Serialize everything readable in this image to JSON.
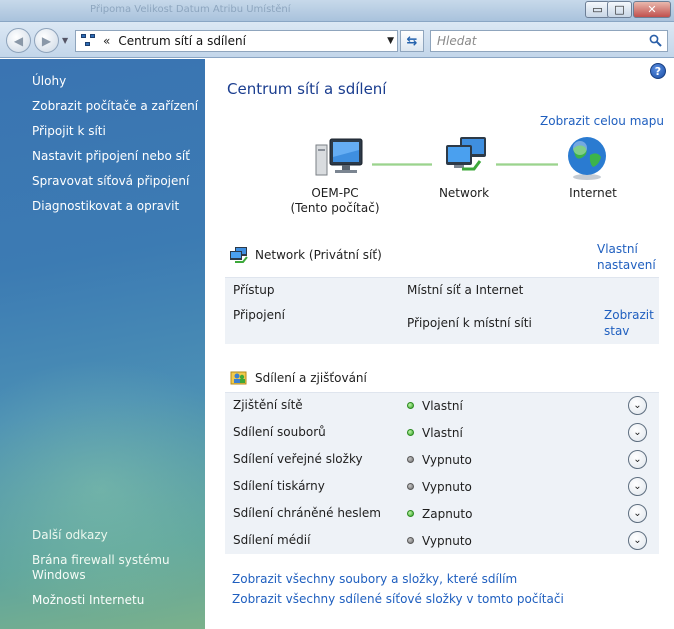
{
  "window": {
    "ghost_text": "Připoma   Velikost  Datum     Atribu  Umístění",
    "buttons": {
      "minimize": "▭",
      "maximize": "□",
      "close": "✕"
    }
  },
  "address": {
    "chevron": "«",
    "path": "Centrum sítí a sdílení",
    "search_placeholder": "Hledat"
  },
  "sidebar": {
    "heading": "Úlohy",
    "tasks": [
      "Zobrazit počítače a zařízení",
      "Připojit k síti",
      "Nastavit připojení nebo síť",
      "Spravovat síťová připojení",
      "Diagnostikovat a opravit"
    ],
    "more_heading": "Další odkazy",
    "more_links": [
      "Brána firewall systému Windows",
      "Možnosti Internetu"
    ]
  },
  "main": {
    "title": "Centrum sítí a sdílení",
    "full_map_link": "Zobrazit celou mapu",
    "help": "?",
    "map": {
      "pc_name": "OEM-PC",
      "pc_sub": "(Tento počítač)",
      "network": "Network",
      "internet": "Internet"
    },
    "network_section": {
      "title": "Network (Privátní síť)",
      "customize_line1": "Vlastní",
      "customize_line2": "nastavení",
      "access_label": "Přístup",
      "access_value": "Místní síť a Internet",
      "connection_label": "Připojení",
      "connection_value": "Připojení k místní síti",
      "view_status_line1": "Zobrazit",
      "view_status_line2": "stav"
    },
    "sharing_section": {
      "title": "Sdílení a zjišťování",
      "rows": [
        {
          "label": "Zjištění sítě",
          "value": "Vlastní",
          "status": "on"
        },
        {
          "label": "Sdílení souborů",
          "value": "Vlastní",
          "status": "on"
        },
        {
          "label": "Sdílení veřejné složky",
          "value": "Vypnuto",
          "status": "off"
        },
        {
          "label": "Sdílení tiskárny",
          "value": "Vypnuto",
          "status": "off"
        },
        {
          "label": "Sdílení chráněné heslem",
          "value": "Zapnuto",
          "status": "on"
        },
        {
          "label": "Sdílení médií",
          "value": "Vypnuto",
          "status": "off"
        }
      ],
      "expand_glyph": "⌄"
    },
    "bottom_links": [
      "Zobrazit všechny soubory a složky, které sdílím",
      "Zobrazit všechny sdílené síťové složky v tomto počítači"
    ]
  }
}
